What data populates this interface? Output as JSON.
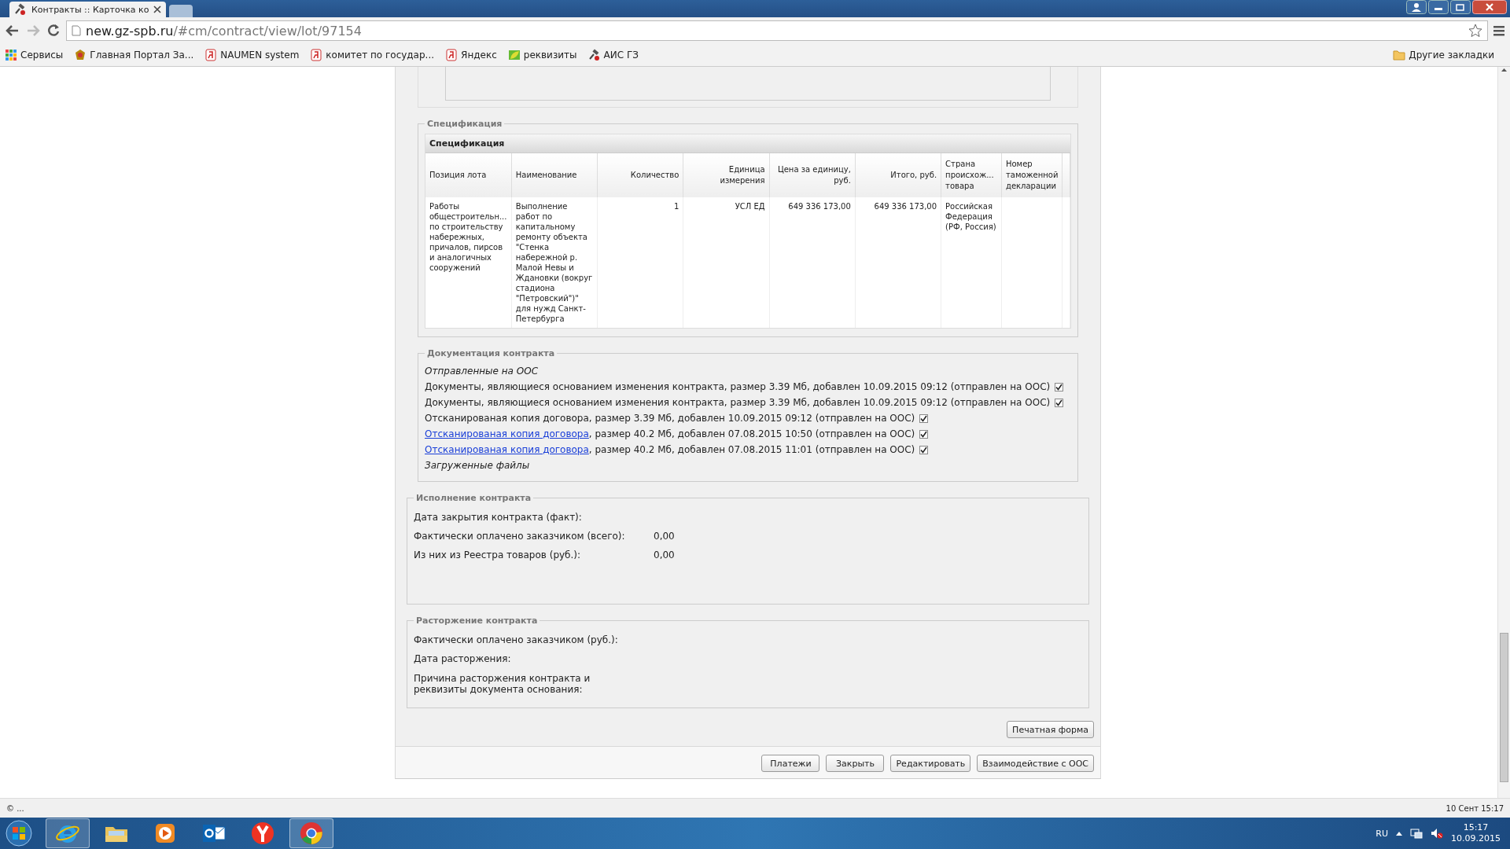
{
  "browser": {
    "tabs": [
      {
        "title": "Контракты :: Карточка ко",
        "selected": true
      },
      {
        "selected": false
      }
    ],
    "address": {
      "host": "new.gz-spb.ru",
      "path": "/#cm/contract/view/lot/97154"
    },
    "bookmarks": [
      {
        "kind": "apps",
        "label": "Сервисы"
      },
      {
        "kind": "emblem",
        "label": "Главная Портал За..."
      },
      {
        "kind": "yandex",
        "label": "NAUMEN system"
      },
      {
        "kind": "yandex",
        "label": "комитет по государ..."
      },
      {
        "kind": "yandex",
        "label": "Яндекс"
      },
      {
        "kind": "leaf",
        "label": "реквизиты"
      },
      {
        "kind": "gavel",
        "label": "АИС ГЗ"
      }
    ],
    "other_bookmarks": "Другие закладки"
  },
  "specification": {
    "legend": "Спецификация",
    "grid_title": "Спецификация",
    "columns": [
      "Позиция лота",
      "Наименование",
      "Количество",
      "Единица измерения",
      "Цена за единицу, руб.",
      "Итого, руб.",
      "Страна происхож... товара",
      "Номер таможенной декларации"
    ],
    "rows": [
      [
        "Работы общестроительн... по строительству набережных, причалов, пирсов и аналогичных сооружений",
        "Выполнение работ по капитальному ремонту объекта \"Стенка набережной р. Малой Невы и Ждановки (вокруг стадиона \"Петровский\")\" для нужд Санкт-Петербурга",
        "1",
        "УСЛ ЕД",
        "649 336 173,00",
        "649 336 173,00",
        "Российская Федерация (РФ, Россия)",
        null
      ]
    ]
  },
  "documentation": {
    "legend": "Документация контракта",
    "sent_heading": "Отправленные на ООС",
    "files": [
      {
        "text": "Документы, являющиеся основанием изменения контракта, размер 3.39 Мб, добавлен 10.09.2015 09:12 (отправлен на ООС)",
        "checked": true
      },
      {
        "text": "Документы, являющиеся основанием изменения контракта, размер 3.39 Мб, добавлен 10.09.2015 09:12 (отправлен на ООС)",
        "checked": true
      },
      {
        "text": "Отсканированая копия договора, размер 3.39 Мб, добавлен 10.09.2015 09:12 (отправлен на ООС)",
        "checked": true
      },
      {
        "link": "Отсканированая копия договора",
        "text": ", размер 40.2 Мб, добавлен 07.08.2015 10:50 (отправлен на ООС)",
        "checked": true
      },
      {
        "link": "Отсканированая копия договора",
        "text": ", размер 40.2 Мб, добавлен 07.08.2015 11:01 (отправлен на ООС)",
        "checked": true
      }
    ],
    "uploaded_heading": "Загруженные файлы"
  },
  "execution": {
    "legend": "Исполнение контракта",
    "fields": [
      {
        "label": "Дата закрытия контракта (факт):"
      },
      {
        "label": "Фактически оплачено заказчиком (всего):",
        "value": "0,00"
      },
      {
        "label": "Из них из Реестра товаров (руб.):",
        "value": "0,00"
      }
    ]
  },
  "termination": {
    "legend": "Расторжение контракта",
    "fields": [
      {
        "label": "Фактически оплачено заказчиком (руб.):"
      },
      {
        "label": "Дата расторжения:"
      },
      {
        "label": "Причина расторжения контракта и реквизиты документа основания:"
      }
    ]
  },
  "print_button": "Печатная форма",
  "buttons": [
    "Платежи",
    "Закрыть",
    "Редактировать",
    "Взаимодействие с ООС"
  ],
  "status_bar": {
    "left": "© ...",
    "right": "10 Сент 15:17"
  },
  "taskbar": {
    "apps": [
      {
        "kind": "ie",
        "running": true
      },
      {
        "kind": "folder",
        "running": false
      },
      {
        "kind": "player",
        "running": false
      },
      {
        "kind": "outlook",
        "running": false
      },
      {
        "kind": "yandex",
        "running": false
      },
      {
        "kind": "chrome",
        "running": true
      }
    ],
    "language": "RU",
    "time": "15:17",
    "date": "10.09.2015"
  }
}
